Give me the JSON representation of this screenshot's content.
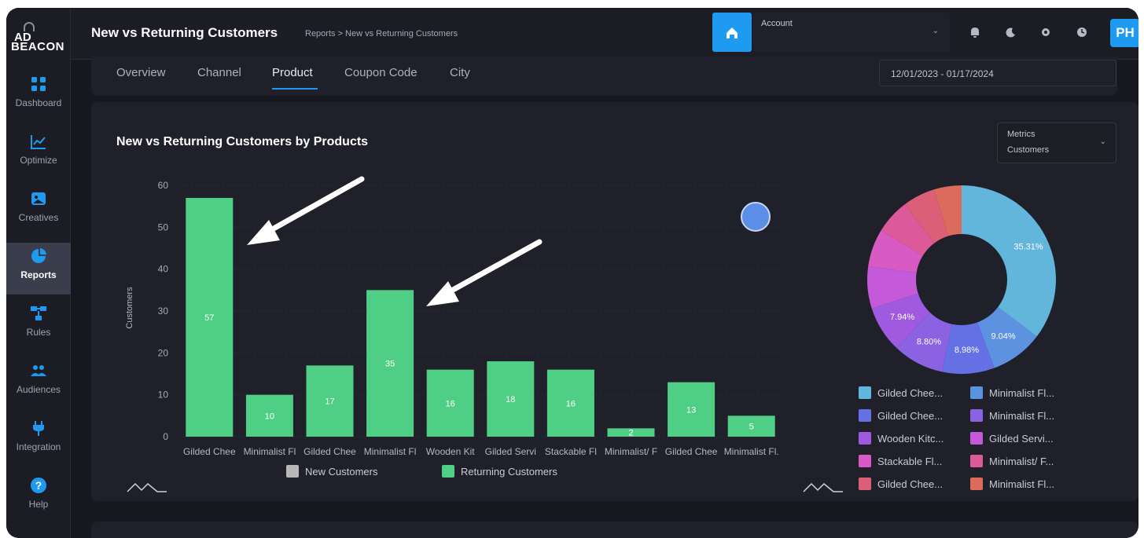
{
  "app": {
    "logo_line1": "AD",
    "logo_line2": "BEACON"
  },
  "sidebar": {
    "items": [
      {
        "label": "Dashboard",
        "icon": "dashboard-grid-icon",
        "active": false
      },
      {
        "label": "Optimize",
        "icon": "line-chart-icon",
        "active": false
      },
      {
        "label": "Creatives",
        "icon": "image-icon",
        "active": false
      },
      {
        "label": "Reports",
        "icon": "pie-chart-icon",
        "active": true
      },
      {
        "label": "Rules",
        "icon": "flow-icon",
        "active": false
      },
      {
        "label": "Audiences",
        "icon": "people-icon",
        "active": false
      },
      {
        "label": "Integration",
        "icon": "plug-icon",
        "active": false
      },
      {
        "label": "Help",
        "icon": "help-icon",
        "active": false
      }
    ]
  },
  "header": {
    "title": "New vs Returning Customers",
    "breadcrumb": "Reports  >  New vs Returning Customers",
    "account_label": "Account",
    "avatar_initials": "PH"
  },
  "tabs": [
    {
      "label": "Overview",
      "active": false
    },
    {
      "label": "Channel",
      "active": false
    },
    {
      "label": "Product",
      "active": true
    },
    {
      "label": "Coupon Code",
      "active": false
    },
    {
      "label": "City",
      "active": false
    }
  ],
  "date_range": "12/01/2023 - 01/17/2024",
  "card": {
    "title": "New vs Returning Customers by Products",
    "metrics_label": "Metrics",
    "metrics_value": "Customers"
  },
  "colors": {
    "accent": "#1e9bf0",
    "bar_returning": "#4fcf86",
    "legend_new": "#b8b8b8"
  },
  "chart_data": [
    {
      "type": "bar",
      "ylabel": "Customers",
      "ylim": [
        0,
        60
      ],
      "yticks": [
        0,
        10,
        20,
        30,
        40,
        50,
        60
      ],
      "categories": [
        "Gilded Chee",
        "Minimalist Fl",
        "Gilded Chee",
        "Minimalist Fl",
        "Wooden Kit",
        "Gilded Servi",
        "Stackable Fl",
        "Minimalist/ F",
        "Gilded Chee",
        "Minimalist Fl."
      ],
      "series": [
        {
          "name": "New Customers",
          "values": [
            0,
            0,
            0,
            0,
            0,
            0,
            0,
            0,
            0,
            0
          ],
          "color": "#b8b8b8"
        },
        {
          "name": "Returning Customers",
          "values": [
            57,
            10,
            17,
            35,
            16,
            18,
            16,
            2,
            13,
            5
          ],
          "color": "#4fcf86"
        }
      ],
      "value_labels": [
        "57",
        "10",
        "17",
        "35",
        "16",
        "18",
        "16",
        "2",
        "13",
        "5"
      ],
      "legend_position": "bottom"
    },
    {
      "type": "pie",
      "slices": [
        {
          "label": "Gilded Chee...",
          "value": 35.31,
          "color": "#62b6dc"
        },
        {
          "label": "Minimalist Fl...",
          "value": 9.04,
          "color": "#5d92e0"
        },
        {
          "label": "Gilded Chee...",
          "value": 8.98,
          "color": "#6570e4"
        },
        {
          "label": "Minimalist Fl...",
          "value": 8.8,
          "color": "#8a62e2"
        },
        {
          "label": "Wooden Kitc...",
          "value": 7.94,
          "color": "#a05adf"
        },
        {
          "label": "Gilded Servi...",
          "value": 7.2,
          "color": "#c45ad9"
        },
        {
          "label": "Stackable Fl...",
          "value": 6.5,
          "color": "#d85bc4"
        },
        {
          "label": "Minimalist/ F...",
          "value": 6.0,
          "color": "#dc5a9a"
        },
        {
          "label": "Gilded Chee...",
          "value": 5.5,
          "color": "#dc5f79"
        },
        {
          "label": "Minimalist Fl...",
          "value": 4.73,
          "color": "#dc6a5d"
        }
      ],
      "slice_labels": [
        "35.31%",
        "9.04%",
        "8.98%",
        "8.80%",
        "7.94%"
      ],
      "legend_position": "bottom"
    }
  ]
}
